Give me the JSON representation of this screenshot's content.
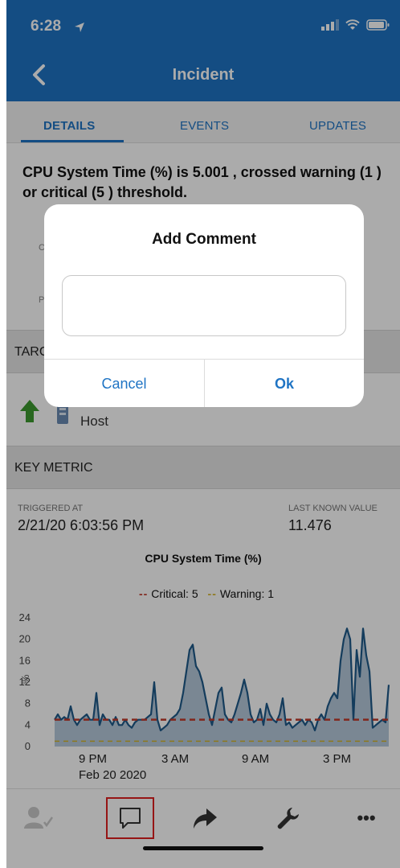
{
  "status": {
    "time": "6:28"
  },
  "nav": {
    "title": "Incident"
  },
  "tabs": [
    {
      "label": "DETAILS",
      "active": true
    },
    {
      "label": "EVENTS",
      "active": false
    },
    {
      "label": "UPDATES",
      "active": false
    }
  ],
  "incident": {
    "headline": "CPU System Time (%) is 5.001 , crossed warning (1 ) or critical (5 ) threshold.",
    "row_label_1": "C",
    "row_label_2": "P"
  },
  "target": {
    "section_title": "TARGET",
    "host_label": "Host"
  },
  "key_metric": {
    "section_title": "KEY METRIC",
    "triggered_label": "TRIGGERED AT",
    "triggered_value": "2/21/20 6:03:56 PM",
    "last_value_label": "LAST KNOWN VALUE",
    "last_value": "11.476"
  },
  "chart_data": {
    "type": "area",
    "title": "CPU System Time (%)",
    "ylabel": "%",
    "ylim": [
      0,
      24
    ],
    "yticks": [
      0,
      4,
      8,
      12,
      16,
      20,
      24
    ],
    "xticks": [
      "9 PM",
      "3 AM",
      "9 AM",
      "3 PM"
    ],
    "x_date_label": "Feb 20 2020",
    "legend": [
      {
        "name": "Critical: 5",
        "value": 5,
        "color": "#c0392b"
      },
      {
        "name": "Warning: 1",
        "value": 1,
        "color": "#d4b52a"
      }
    ],
    "series": [
      {
        "values": [
          5,
          6,
          5,
          5.5,
          5,
          7.5,
          5,
          4,
          5,
          5.5,
          6,
          5,
          5,
          10,
          4,
          6,
          5,
          5,
          4,
          5.5,
          4,
          4,
          5,
          4,
          3.5,
          4.5,
          5,
          5,
          5,
          5.5,
          6,
          12,
          5,
          3,
          3.5,
          4,
          5,
          5.5,
          6,
          7,
          10,
          14,
          18,
          19,
          15,
          14,
          12,
          9,
          6,
          4,
          7,
          10,
          11,
          6,
          5,
          4.5,
          6,
          8,
          10,
          12.5,
          10,
          6,
          4.5,
          5,
          7,
          4,
          8,
          6,
          5,
          4.5,
          6,
          9,
          4,
          4.5,
          3.5,
          4,
          4.5,
          5,
          4,
          5,
          4.5,
          3,
          5,
          6,
          5,
          7.5,
          9,
          10,
          9,
          16,
          20,
          22,
          20,
          5,
          18,
          13,
          22,
          17,
          14,
          3.5,
          4,
          4.5,
          5,
          4.5,
          11.5
        ],
        "color": "#1f5a8a",
        "fill": "#a9c1d6"
      }
    ]
  },
  "toolbar": {
    "items": [
      "acknowledge-icon",
      "comment-icon",
      "forward-icon",
      "wrench-icon",
      "more-icon"
    ],
    "more_label": "•••"
  },
  "dialog": {
    "title": "Add Comment",
    "input_value": "",
    "cancel_label": "Cancel",
    "ok_label": "Ok"
  }
}
